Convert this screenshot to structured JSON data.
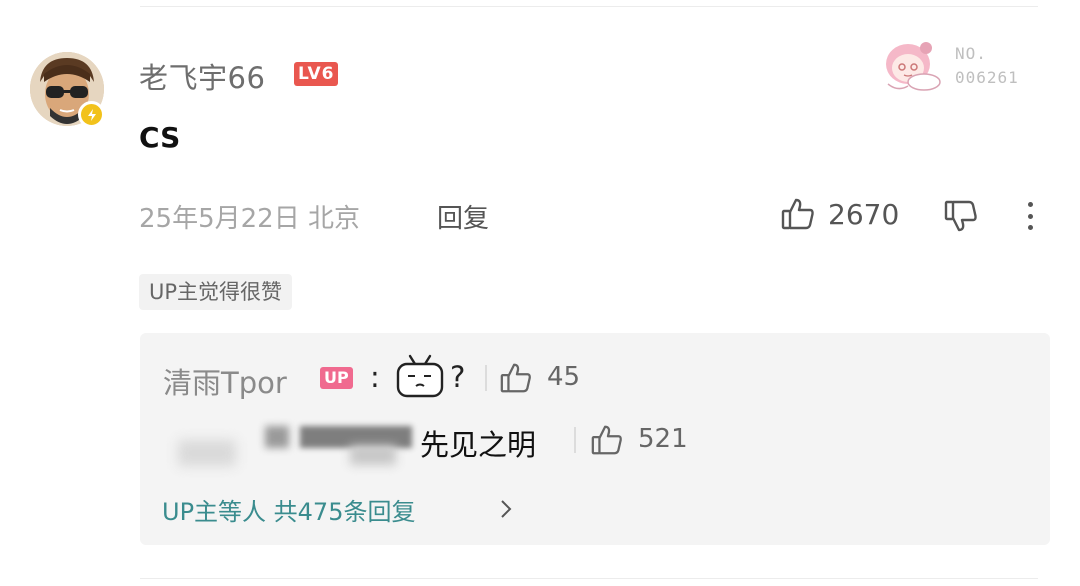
{
  "comment": {
    "username": "老飞宇66",
    "level": "LV6",
    "text": "CS",
    "date_location": "25年5月22日 北京",
    "reply_label": "回复",
    "likes": "2670",
    "up_liked_tag": "UP主觉得很赞",
    "pendant_no_label": "NO.",
    "pendant_no": "006261"
  },
  "replies": [
    {
      "name": "清雨Tpor",
      "badge": "UP",
      "colon": ":",
      "after_emoji": "?",
      "likes": "45"
    },
    {
      "text": "先见之明",
      "likes": "521"
    }
  ],
  "more_replies_label": "UP主等人 共475条回复",
  "colors": {
    "level_badge": "#e9574f",
    "up_badge": "#f06a8f",
    "link": "#3a8c8e",
    "reply_box_bg": "#f4f4f4"
  },
  "icons": [
    "avatar",
    "lightning-badge-icon",
    "thumbs-up-icon",
    "thumbs-down-icon",
    "more-vertical-icon",
    "tv-emoji-icon",
    "chevron-right-icon"
  ]
}
